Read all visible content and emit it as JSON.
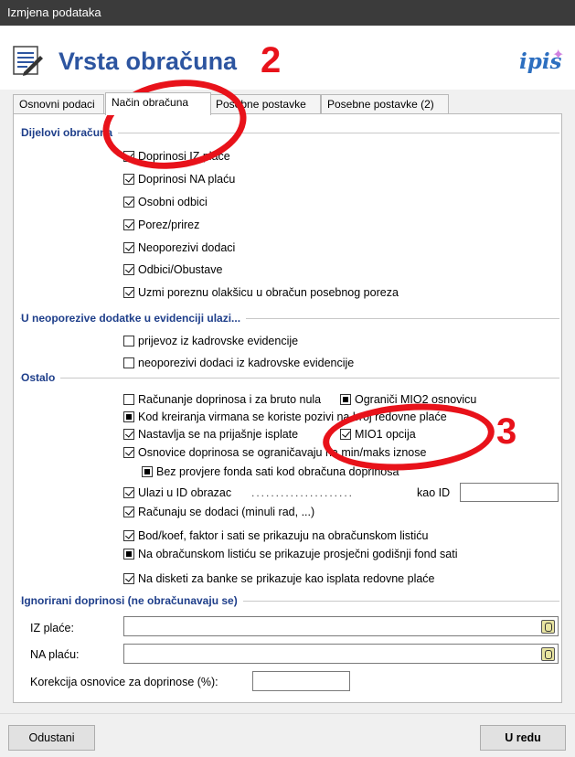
{
  "window": {
    "title": "Izmjena podataka"
  },
  "header": {
    "title": "Vrsta obračuna",
    "logo": "ipis",
    "logo_icon": "star-icon"
  },
  "tabs": [
    {
      "label": "Osnovni podaci",
      "active": false
    },
    {
      "label": "Način obračuna",
      "active": true
    },
    {
      "label": "Posebne postavke",
      "active": false
    },
    {
      "label": "Posebne postavke (2)",
      "active": false
    }
  ],
  "groups": {
    "dijelovi": {
      "label": "Dijelovi obračuna",
      "items": [
        {
          "label": "Doprinosi IZ plaće",
          "state": "checked"
        },
        {
          "label": "Doprinosi NA plaću",
          "state": "checked"
        },
        {
          "label": "Osobni odbici",
          "state": "checked"
        },
        {
          "label": "Porez/prirez",
          "state": "checked"
        },
        {
          "label": "Neoporezivi dodaci",
          "state": "checked"
        },
        {
          "label": "Odbici/Obustave",
          "state": "checked"
        },
        {
          "label": "Uzmi poreznu olakšicu u obračun posebnog poreza",
          "state": "checked"
        }
      ]
    },
    "neoporezive": {
      "label": "U neoporezive dodatke u evidenciji ulazi...",
      "items": [
        {
          "label": "prijevoz iz kadrovske evidencije",
          "state": "unchecked"
        },
        {
          "label": "neoporezivi dodaci iz kadrovske evidencije",
          "state": "unchecked"
        }
      ]
    },
    "ostalo": {
      "label": "Ostalo",
      "items": {
        "racunanje": {
          "label": "Računanje doprinosa i za bruto nula",
          "state": "unchecked"
        },
        "ograniči": {
          "label": "Ograniči MIO2 osnovicu",
          "state": "indeterminate"
        },
        "kod_kreiranja": {
          "label": "Kod kreiranja virmana se koriste pozivi na broj redovne plaće",
          "state": "indeterminate"
        },
        "nastavlja": {
          "label": "Nastavlja se na prijašnje isplate",
          "state": "checked"
        },
        "mio1": {
          "label": "MIO1 opcija",
          "state": "checked"
        },
        "osnovice": {
          "label": "Osnovice doprinosa se ograničavaju na min/maks iznose",
          "state": "checked"
        },
        "bez_provjere": {
          "label": "Bez provjere fonda sati kod obračuna doprinosa",
          "state": "indeterminate"
        },
        "ulazi_id": {
          "label": "Ulazi u ID obrazac",
          "state": "checked"
        },
        "kao_id": {
          "label": "kao ID",
          "value": ""
        },
        "racunaju_dodaci": {
          "label": "Računaju se dodaci (minuli rad, ...)",
          "state": "checked"
        },
        "bod_koef": {
          "label": "Bod/koef, faktor i sati se prikazuju na obračunskom listiću",
          "state": "checked"
        },
        "na_obracunskom": {
          "label": "Na obračunskom listiću se prikazuje prosječni godišnji fond sati",
          "state": "indeterminate"
        },
        "na_disketi": {
          "label": "Na disketi za banke se prikazuje kao isplata redovne plaće",
          "state": "checked"
        }
      }
    },
    "ignorirani": {
      "label": "Ignorirani doprinosi (ne obračunavaju se)",
      "iz_place": {
        "label": "IZ plaće:",
        "value": ""
      },
      "na_placu": {
        "label": "NA plaću:",
        "value": ""
      },
      "korekcija": {
        "label": "Korekcija osnovice za doprinose (%):",
        "value": ""
      }
    }
  },
  "footer": {
    "cancel": "Odustani",
    "ok": "U redu"
  },
  "annotations": {
    "a2": "2",
    "a3": "3",
    "color": "#e8121a"
  }
}
